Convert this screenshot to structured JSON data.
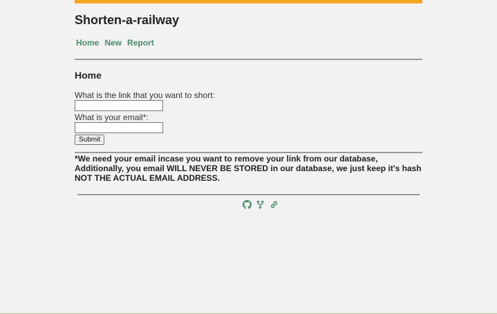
{
  "site": {
    "title": "Shorten-a-railway",
    "accent_color": "#f5a623",
    "link_color": "#4a8a6a"
  },
  "nav": {
    "items": [
      {
        "label": "Home"
      },
      {
        "label": "New"
      },
      {
        "label": "Report"
      }
    ]
  },
  "main": {
    "heading": "Home",
    "form": {
      "link_label": "What is the link that you want to short:",
      "link_value": "",
      "email_label": "What is your email*:",
      "email_value": "",
      "submit_label": "Submit"
    },
    "notice": {
      "line1": "*We need your email incase you want to remove your link from our database,",
      "line2": "Additionally, you email WILL NEVER BE STORED in our database, we just keep it's hash",
      "line3": "NOT THE ACTUAL EMAIL ADDRESS."
    }
  },
  "footer": {
    "icons": [
      "github-icon",
      "fork-icon",
      "link-icon"
    ]
  }
}
